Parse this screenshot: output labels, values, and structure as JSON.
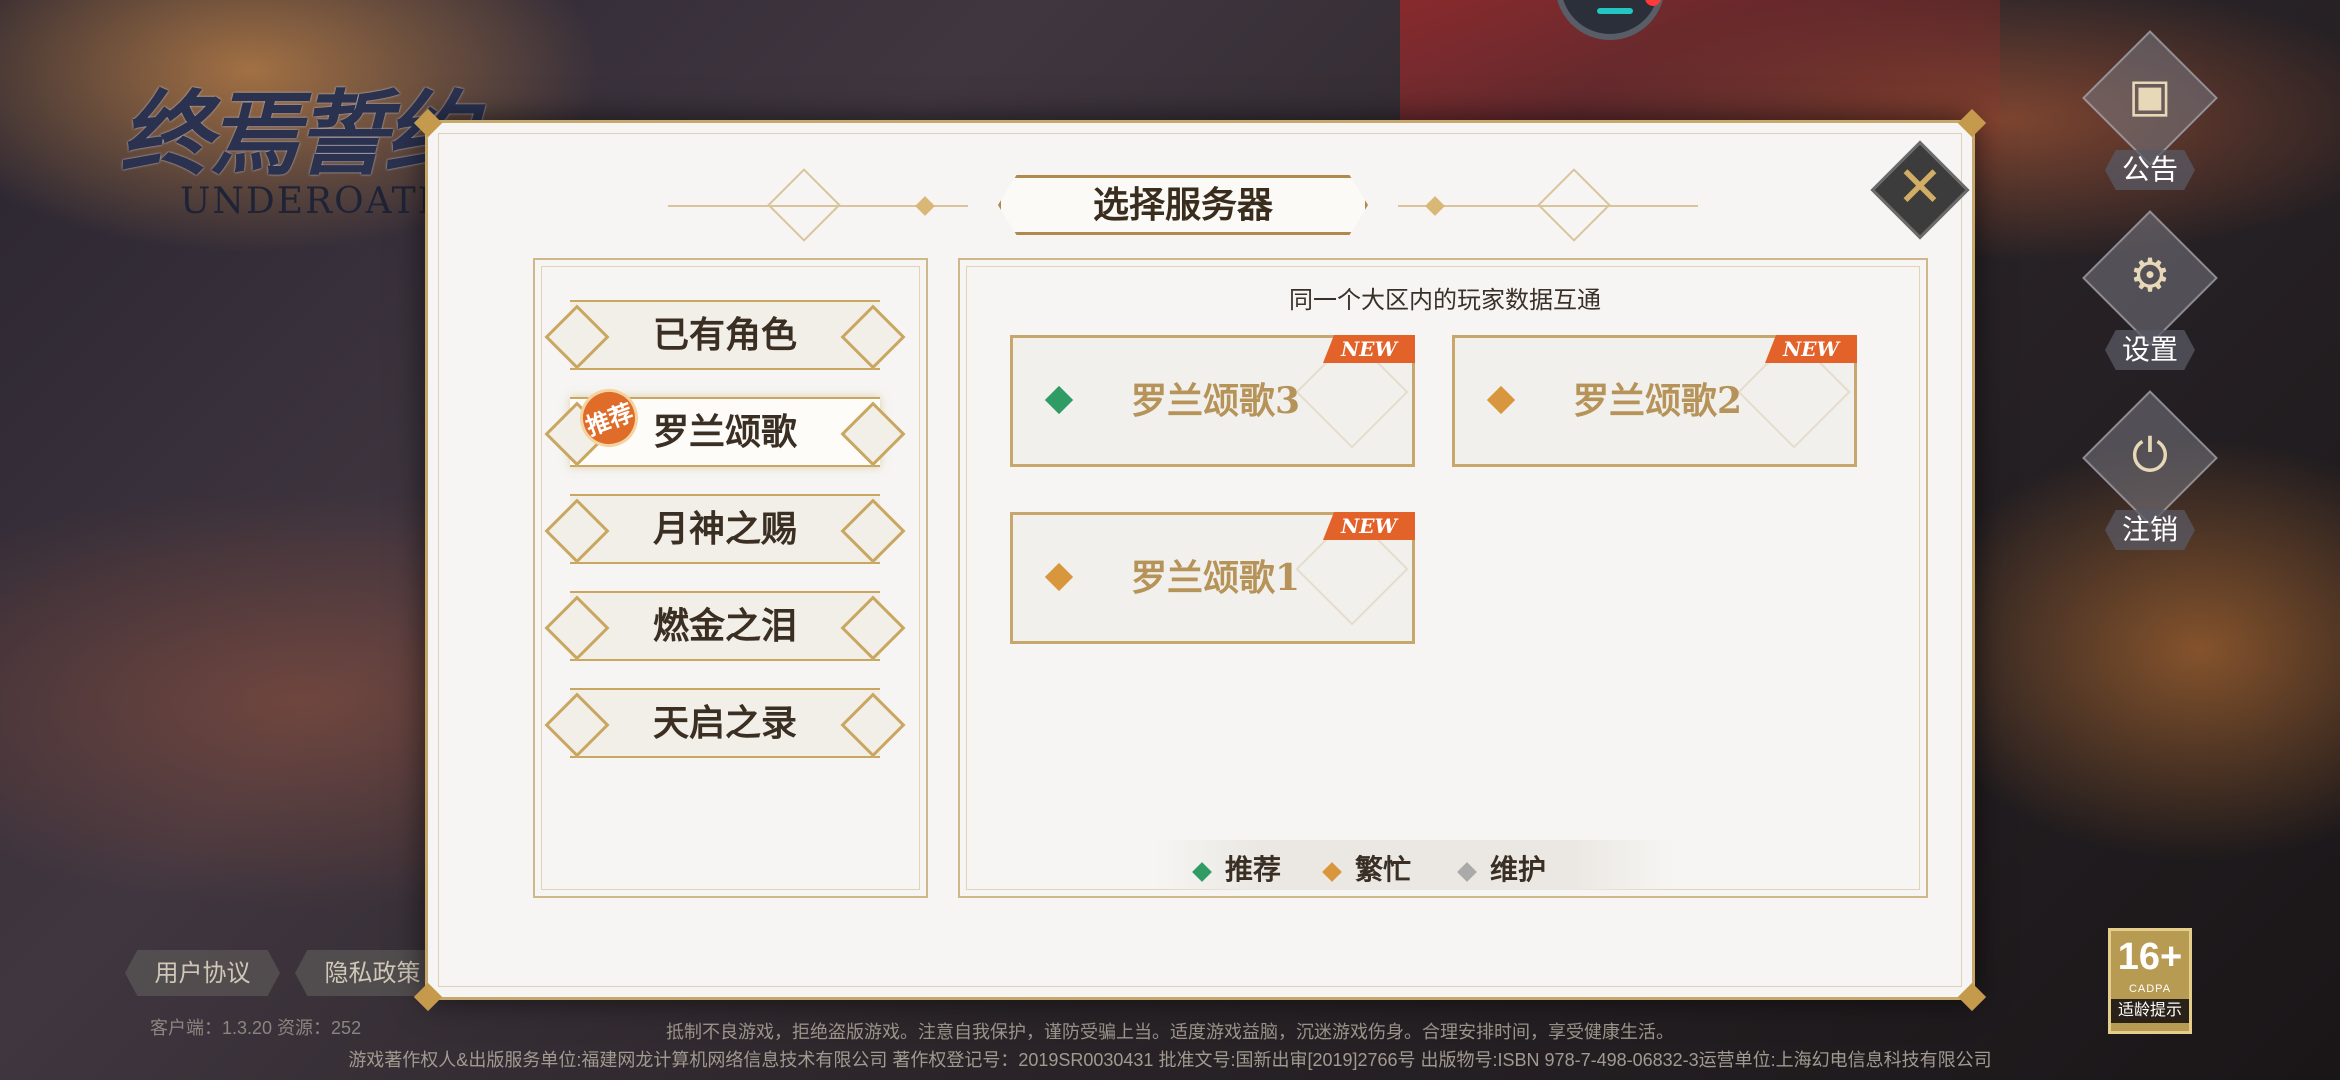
{
  "logo": {
    "title_cn": "终焉誓约",
    "title_en": "UNDEROATH"
  },
  "dialog": {
    "title": "选择服务器",
    "note": "同一个大区内的玩家数据互通"
  },
  "regions": [
    {
      "label": "已有角色",
      "selected": false
    },
    {
      "label": "罗兰颂歌",
      "selected": true,
      "badge": "推荐"
    },
    {
      "label": "月神之赐",
      "selected": false
    },
    {
      "label": "燃金之泪",
      "selected": false
    },
    {
      "label": "天启之录",
      "selected": false
    }
  ],
  "servers": [
    {
      "name": "罗兰颂歌3",
      "status": "recommended",
      "tag": "NEW"
    },
    {
      "name": "罗兰颂歌2",
      "status": "busy",
      "tag": "NEW"
    },
    {
      "name": "罗兰颂歌1",
      "status": "busy",
      "tag": "NEW"
    }
  ],
  "legend": [
    {
      "label": "推荐",
      "color": "#2e9c63"
    },
    {
      "label": "繁忙",
      "color": "#d8973d"
    },
    {
      "label": "维护",
      "color": "#aaaaaa"
    }
  ],
  "side_menu": [
    {
      "label": "公告",
      "icon": "notice-board-icon"
    },
    {
      "label": "设置",
      "icon": "gear-icon"
    },
    {
      "label": "注销",
      "icon": "power-icon"
    }
  ],
  "links": {
    "user_agreement": "用户协议",
    "privacy_policy": "隐私政策"
  },
  "version_text": "客户端：1.3.20  资源：252",
  "age_rating": {
    "number": "16+",
    "org": "CADPA",
    "label": "适龄提示"
  },
  "footer": {
    "line1": "抵制不良游戏，拒绝盗版游戏。注意自我保护，谨防受骗上当。适度游戏益脑，沉迷游戏伤身。合理安排时间，享受健康生活。",
    "line2": "游戏著作权人&出版服务单位:福建网龙计算机网络信息技术有限公司  著作权登记号：2019SR0030431  批准文号:国新出审[2019]2766号  出版物号:ISBN 978-7-498-06832-3运营单位:上海幻电信息科技有限公司"
  },
  "colors": {
    "accent_gold": "#c7a86b",
    "recommended": "#2e9c63",
    "busy": "#d8973d",
    "maintenance": "#aaaaaa",
    "new_tag": "#e2622a"
  }
}
